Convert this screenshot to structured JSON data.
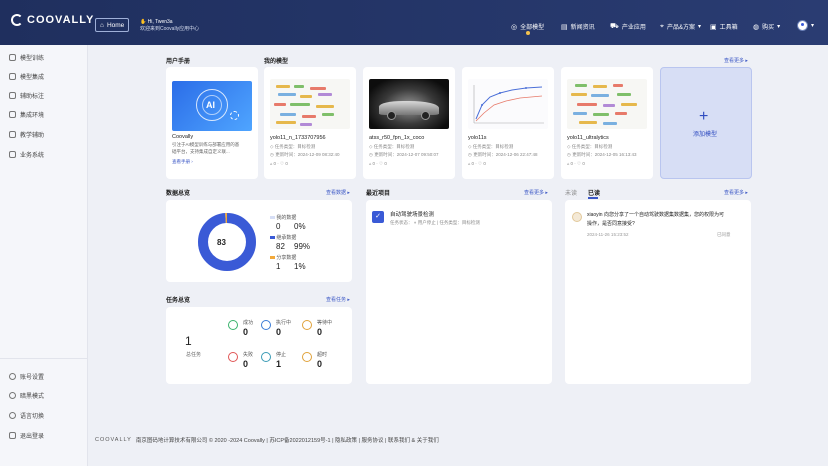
{
  "header": {
    "logo": "COOVALLY",
    "home_label": "Home",
    "greeting": "Hi,",
    "username": "Twen3a",
    "welcome": "欢迎来到Coovally应用中心",
    "nav": [
      "全部模型",
      "新闻资讯",
      "产业应用",
      "产品&方案",
      "工具箱",
      "购买"
    ]
  },
  "sidebar": {
    "items": [
      "模型训练",
      "模型集成",
      "辅助标注",
      "集成环境",
      "教学辅助",
      "业务系统"
    ],
    "bottom_items": [
      "账号设置",
      "暗黑模式",
      "语言切换",
      "退出登录"
    ]
  },
  "manual": {
    "title": "用户手册",
    "card_title": "Coovally",
    "card_desc_1": "引注于AI模型训练与部署应用的基",
    "card_desc_2": "础平台，支持集成自定义联...",
    "link": "查看手册",
    "thumb_text": "AI"
  },
  "models": {
    "title": "我的模型",
    "more": "查看更多",
    "items": [
      {
        "name": "yolo11_n_1733707956",
        "type": "任务类型：目标检测",
        "date": "更新时间：2024-12-09 08:32:40",
        "likes": "0",
        "favs": "0"
      },
      {
        "name": "atss_r50_fpn_1x_coco",
        "type": "任务类型：目标检测",
        "date": "更新时间：2024-12-07 09:50:07",
        "likes": "0",
        "favs": "0"
      },
      {
        "name": "yolo11s",
        "type": "任务类型：目标检测",
        "date": "更新时间：2024-12-06 22:47:48",
        "likes": "0",
        "favs": "0"
      },
      {
        "name": "yolo11_ultralytics",
        "type": "任务类型：目标检测",
        "date": "更新时间：2024-12-05 16:13:43",
        "likes": "0",
        "favs": "0"
      }
    ],
    "add_label": "添加模型",
    "add_glyph": "+"
  },
  "data_overview": {
    "title": "数据总览",
    "more": "查看数据",
    "total": "83",
    "legend": [
      {
        "name": "我的数据",
        "count": "0",
        "pct": "0%",
        "color": "#d6def5"
      },
      {
        "name": "继承数据",
        "count": "82",
        "pct": "99%",
        "color": "#3a5ad6"
      },
      {
        "name": "分享数据",
        "count": "1",
        "pct": "1%",
        "color": "#f2a93b"
      }
    ]
  },
  "recent": {
    "title": "最近项目",
    "more": "查看更多",
    "project_name": "自动驾驶场景检测",
    "project_meta_status": "任务状态：",
    "project_meta": "用户停止 | 任务类型：目标检测"
  },
  "messages": {
    "tab_unread": "未读",
    "tab_read": "已读",
    "more": "查看更多",
    "sender": "xiaoyin",
    "text_1": "向您分享了一个自动驾驶数据集数据集，您的权限为可",
    "text_2": "操作，是否同意接受?",
    "date": "2024-11-26 15:23:52",
    "status": "已同意"
  },
  "tasks": {
    "title": "任务总览",
    "more": "查看任务",
    "total": "1",
    "total_label": "总任务",
    "stats": [
      {
        "label": "成功",
        "value": "0",
        "color": "#39b36c"
      },
      {
        "label": "执行中",
        "value": "0",
        "color": "#3a7bd5"
      },
      {
        "label": "等待中",
        "value": "0",
        "color": "#e0a23a"
      },
      {
        "label": "失败",
        "value": "0",
        "color": "#e05555"
      },
      {
        "label": "停止",
        "value": "1",
        "color": "#3a9bb5"
      },
      {
        "label": "超时",
        "value": "0",
        "color": "#e0a23a"
      }
    ]
  },
  "footer": {
    "brand": "COOVALLY",
    "text": "南京图码地计算技术有限公司 © 2020 -2024 Coovally | 苏ICP备2022012159号-1 | 隐私政策 | 服务协议 | 联系我们 & 关于我们"
  }
}
